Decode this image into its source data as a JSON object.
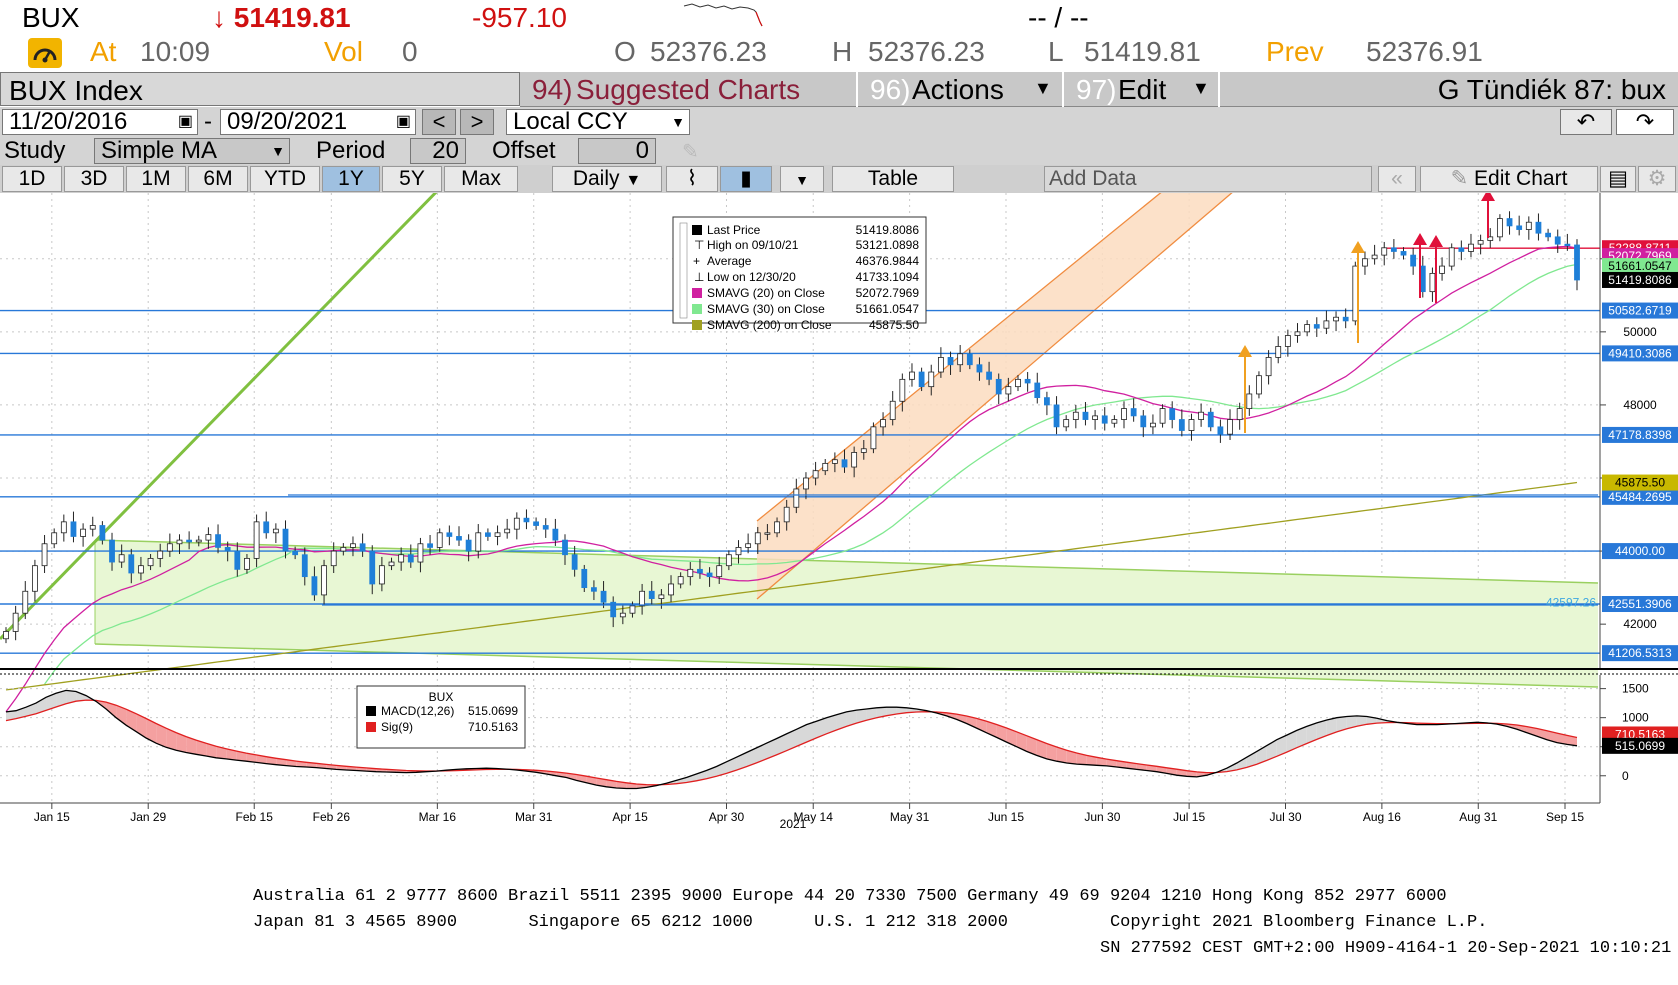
{
  "quote": {
    "ticker": "BUX",
    "last": "↓ 51419.81",
    "change": "-957.10",
    "dash": "-- / --",
    "at_label": "At",
    "time": "10:09",
    "vol_label": "Vol",
    "vol": "0",
    "open_label": "O",
    "open": "52376.23",
    "high_label": "H",
    "high": "52376.23",
    "low_label": "L",
    "low": "51419.81",
    "prev_label": "Prev",
    "prev": "52376.91"
  },
  "titlebar": {
    "security": "BUX Index",
    "suggested_num": "94)",
    "suggested": "Suggested Charts",
    "actions_num": "96)",
    "actions": "Actions",
    "edit_num": "97)",
    "edit": "Edit",
    "page": "G Tündiék 87: bux"
  },
  "controls": {
    "start_date": "11/20/2016",
    "dash": "-",
    "end_date": "09/20/2021",
    "currency": "Local CCY",
    "study_label": "Study",
    "study": "Simple MA",
    "period_label": "Period",
    "period": "20",
    "offset_label": "Offset",
    "offset": "0"
  },
  "toolbar": {
    "ranges": [
      "1D",
      "3D",
      "1M",
      "6M",
      "YTD",
      "1Y",
      "5Y",
      "Max"
    ],
    "active": "1Y",
    "frequency": "Daily",
    "table": "Table",
    "add_data": "Add Data",
    "edit_chart": "Edit Chart"
  },
  "colors": {
    "candle_up": "#ffffff",
    "candle_down": "#1e7fd8",
    "sma20": "#d020a0",
    "sma30": "#80e890",
    "sma200": "#a0a020",
    "channel_green": "#e8f7d4",
    "channel_orange": "#fcdcc0",
    "level_blue": "#2878d8",
    "macd": "#000000",
    "sig": "#e02020"
  },
  "chart_data": {
    "type": "candlestick",
    "title": "BUX",
    "ylim": [
      40800,
      53800
    ],
    "x_ticks": [
      "Jan 15",
      "Jan 29",
      "Feb 15",
      "Feb 26",
      "Mar 16",
      "Mar 31",
      "Apr 15",
      "Apr 30",
      "May 14",
      "May 31",
      "Jun 15",
      "Jun 30",
      "Jul 15",
      "Jul 30",
      "Aug 16",
      "Aug 31",
      "Sep 15"
    ],
    "x_year": "2021",
    "y_ticks": [
      42000,
      44000,
      46000,
      48000,
      50000,
      52000
    ],
    "y_tick_labels": [
      "42000",
      "44000",
      "",
      "48000",
      "50000",
      ""
    ],
    "closes": [
      41800,
      42300,
      42900,
      43600,
      44200,
      44500,
      44800,
      44400,
      44600,
      44700,
      44300,
      43700,
      43900,
      43400,
      43600,
      43800,
      44000,
      44200,
      44300,
      44250,
      44300,
      44450,
      44100,
      44000,
      43500,
      43800,
      44800,
      44500,
      44600,
      44000,
      43900,
      43300,
      42800,
      43600,
      44000,
      44100,
      44200,
      44000,
      43100,
      43600,
      43700,
      43900,
      43700,
      44200,
      44100,
      44500,
      44400,
      44300,
      44000,
      44500,
      44400,
      44500,
      44600,
      44900,
      44800,
      44700,
      44600,
      44300,
      43900,
      43500,
      43000,
      42900,
      42600,
      42200,
      42300,
      42500,
      42900,
      42700,
      42800,
      43100,
      43300,
      43500,
      43400,
      43300,
      43600,
      43900,
      44100,
      44200,
      44500,
      44500,
      44800,
      45200,
      45700,
      46000,
      46200,
      46400,
      46500,
      46300,
      46700,
      46800,
      47400,
      47600,
      48100,
      48700,
      48900,
      48500,
      48900,
      49300,
      49100,
      49400,
      49100,
      48900,
      48700,
      48300,
      48500,
      48700,
      48600,
      48200,
      48000,
      47400,
      47600,
      47800,
      47600,
      47700,
      47500,
      47600,
      47900,
      47700,
      47400,
      47500,
      47900,
      47600,
      47300,
      47600,
      47800,
      47400,
      47200,
      47600,
      47900,
      48300,
      48800,
      49300,
      49600,
      49900,
      50000,
      50200,
      50100,
      50300,
      50400,
      50300,
      51800,
      52000,
      52100,
      52300,
      52200,
      52100,
      51800,
      51100,
      51600,
      51800,
      52300,
      52200,
      52400,
      52500,
      52600,
      53100,
      52900,
      52800,
      53000,
      52700,
      52600,
      52400,
      52376.9,
      51419.81
    ],
    "series": [
      {
        "name": "SMAVG (20) on Close",
        "last": "52072.7969"
      },
      {
        "name": "SMAVG (30) on Close",
        "last": "51661.0547"
      },
      {
        "name": "SMAVG (200) on Close",
        "last": "45875.50"
      }
    ],
    "legend": {
      "last_price_label": "Last Price",
      "last_price": "51419.8086",
      "high_label": "High on 09/10/21",
      "high": "53121.0898",
      "avg_label": "Average",
      "avg": "46376.9844",
      "low_label": "Low on 12/30/20",
      "low": "41733.1094",
      "sma20_label": "SMAVG (20)  on Close",
      "sma20": "52072.7969",
      "sma30_label": "SMAVG (30)  on Close",
      "sma30": "51661.0547",
      "sma200_label": "SMAVG (200)  on Close",
      "sma200": "45875.50"
    },
    "levels": [
      {
        "value": 52288.8711,
        "label": "52288.8711",
        "color": "#e0103a"
      },
      {
        "value": 50582.6719,
        "label": "50582.6719",
        "color": "#2878d8"
      },
      {
        "value": 49410.3086,
        "label": "49410.3086",
        "color": "#2878d8"
      },
      {
        "value": 47178.8398,
        "label": "47178.8398",
        "color": "#2878d8"
      },
      {
        "value": 45484.2695,
        "label": "45484.2695",
        "color": "#2878d8"
      },
      {
        "value": 44000.0,
        "label": "44000.00",
        "color": "#2878d8"
      },
      {
        "value": 42551.3906,
        "label": "42551.3906",
        "color": "#2878d8"
      },
      {
        "value": 41206.5313,
        "label": "41206.5313",
        "color": "#2878d8"
      }
    ],
    "right_labels": {
      "sma200": "45875.50",
      "last": "51419.8086",
      "sma20": "52072.7969",
      "sma30": "51661.0547",
      "channel": "42597.26"
    },
    "macd": {
      "title": "BUX",
      "macd_label": "MACD(12,26)",
      "macd_value": "515.0699",
      "sig_label": "Sig(9)",
      "sig_value": "710.5163",
      "ylim": [
        -400,
        1700
      ],
      "y_ticks": [
        0,
        500,
        1000,
        1500
      ],
      "y_tick_labels": [
        "0",
        "",
        "1000",
        "1500"
      ],
      "last_sig": "710.5163",
      "last_macd": "515.0699",
      "values": [
        1100,
        1120,
        1180,
        1250,
        1350,
        1420,
        1470,
        1450,
        1380,
        1280,
        1150,
        1000,
        870,
        760,
        650,
        560,
        490,
        440,
        400,
        370,
        340,
        310,
        290,
        270,
        250,
        230,
        210,
        190,
        175,
        160,
        150,
        140,
        125,
        110,
        100,
        90,
        80,
        70,
        65,
        60,
        55,
        60,
        70,
        80,
        95,
        110,
        120,
        125,
        130,
        125,
        115,
        100,
        80,
        60,
        30,
        0,
        -30,
        -80,
        -120,
        -160,
        -190,
        -210,
        -220,
        -220,
        -200,
        -170,
        -130,
        -80,
        -30,
        30,
        90,
        160,
        240,
        320,
        400,
        480,
        560,
        640,
        720,
        800,
        880,
        940,
        1000,
        1050,
        1100,
        1130,
        1150,
        1170,
        1180,
        1180,
        1170,
        1150,
        1120,
        1080,
        1030,
        970,
        900,
        820,
        740,
        660,
        580,
        500,
        420,
        350,
        290,
        250,
        220,
        200,
        190,
        180,
        170,
        150,
        130,
        110,
        90,
        70,
        40,
        10,
        -10,
        -20,
        10,
        60,
        130,
        220,
        320,
        420,
        520,
        620,
        700,
        780,
        850,
        910,
        960,
        1000,
        1020,
        1030,
        1020,
        990,
        950,
        920,
        900,
        880,
        880,
        880,
        890,
        900,
        910,
        920,
        910,
        890,
        850,
        800,
        740,
        680,
        620,
        570,
        540,
        515.0699
      ]
    }
  },
  "footer": {
    "line1": "Australia 61 2 9777 8600 Brazil 5511 2395 9000 Europe 44 20 7330 7500 Germany 49 69 9204 1210 Hong Kong 852 2977 6000",
    "line2": "Japan 81 3 4565 8900       Singapore 65 6212 1000      U.S. 1 212 318 2000          Copyright 2021 Bloomberg Finance L.P.",
    "line3": "SN 277592 CEST GMT+2:00 H909-4164-1 20-Sep-2021 10:10:21"
  }
}
